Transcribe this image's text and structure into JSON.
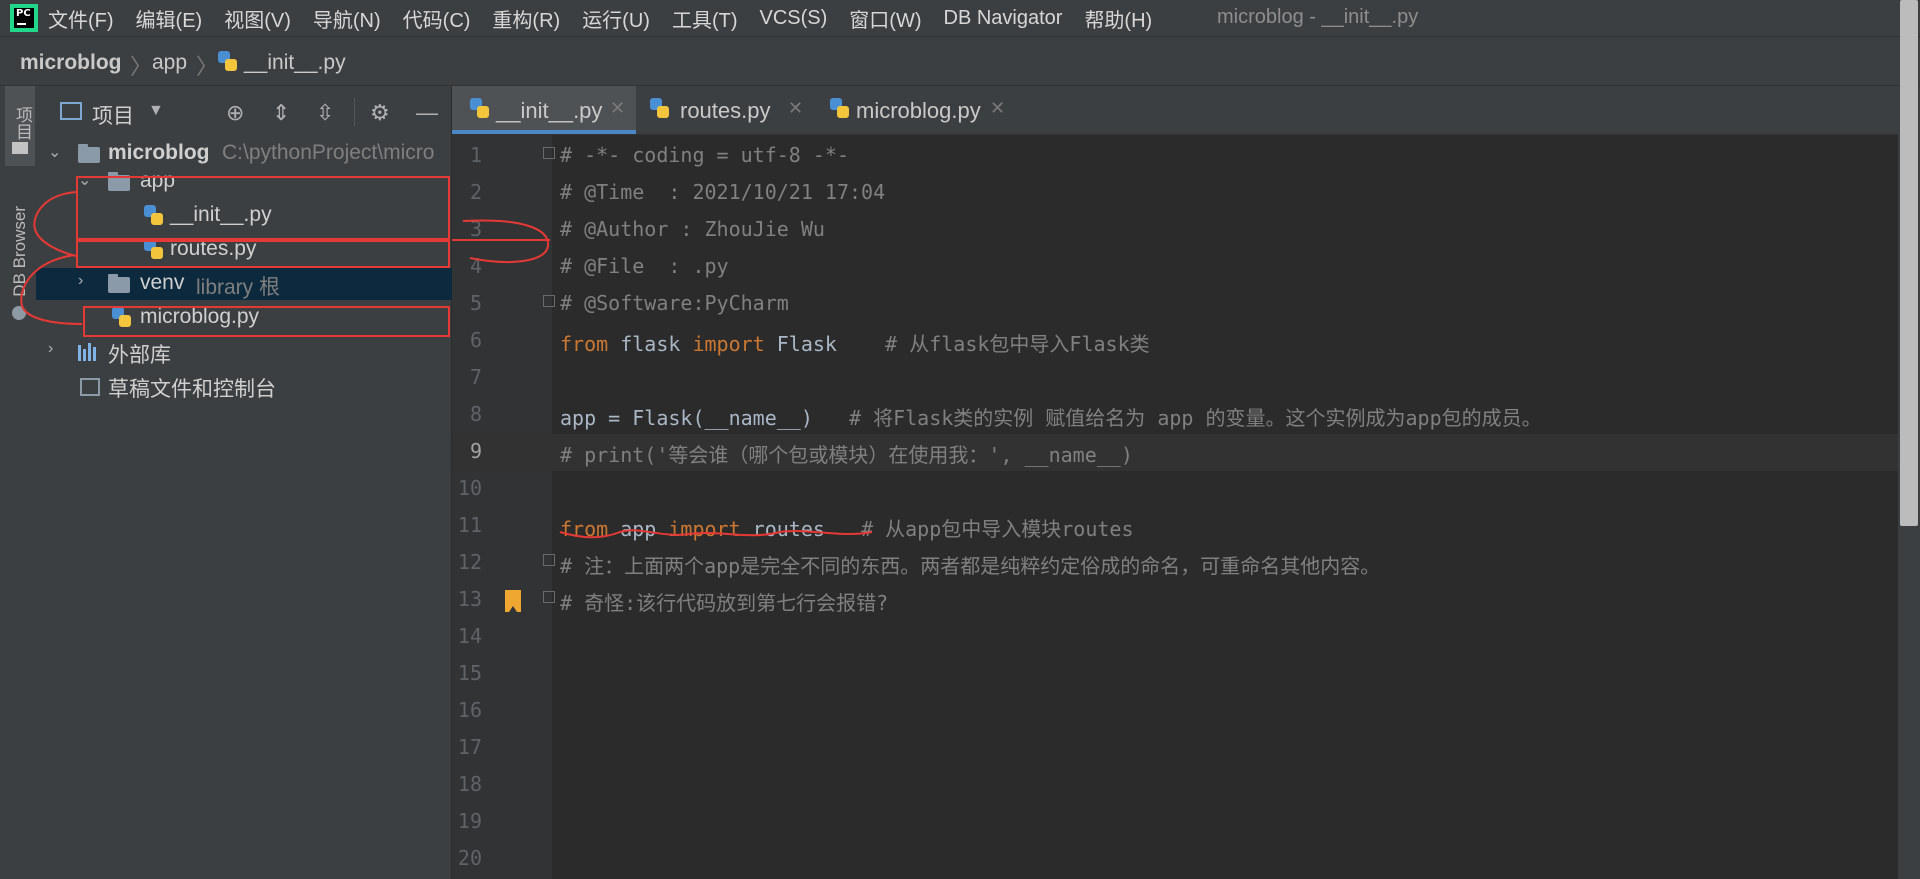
{
  "app": {
    "logo_text": "PC",
    "menus": [
      "文件(F)",
      "编辑(E)",
      "视图(V)",
      "导航(N)",
      "代码(C)",
      "重构(R)",
      "运行(U)",
      "工具(T)",
      "VCS(S)",
      "窗口(W)",
      "DB Navigator",
      "帮助(H)"
    ],
    "window_title": "microblog - __init__.py"
  },
  "breadcrumb": [
    "microblog",
    "app",
    "__init__.py"
  ],
  "toolstrip": {
    "project_label": "项目",
    "db_browser_label": "DB Browser"
  },
  "project_panel": {
    "title": "项目",
    "tree": [
      {
        "label": "microblog",
        "hint": "C:\\pythonProject\\micro"
      },
      {
        "label": "app"
      },
      {
        "label": "__init__.py"
      },
      {
        "label": "routes.py"
      },
      {
        "label": "venv",
        "hint": "library 根"
      },
      {
        "label": "microblog.py"
      },
      {
        "label": "外部库"
      },
      {
        "label": "草稿文件和控制台"
      }
    ]
  },
  "tabs": [
    {
      "label": "__init__.py",
      "active": true
    },
    {
      "label": "routes.py",
      "active": false
    },
    {
      "label": "microblog.py",
      "active": false
    }
  ],
  "editor": {
    "current_line": 9,
    "line_numbers": [
      "1",
      "2",
      "3",
      "4",
      "5",
      "6",
      "7",
      "8",
      "9",
      "10",
      "11",
      "12",
      "13",
      "14",
      "15",
      "16",
      "17",
      "18",
      "19",
      "20"
    ],
    "lines": {
      "l1": "# -*- coding = utf-8 -*-",
      "l2": "# @Time  : 2021/10/21 17:04",
      "l3": "# @Author : ZhouJie Wu",
      "l4": "# @File  : .py",
      "l5": "# @Software:PyCharm",
      "l6": {
        "kw1": "from",
        "mod": " flask ",
        "kw2": "import",
        "name": " Flask    ",
        "comment": "# 从flask包中导入Flask类"
      },
      "l8": {
        "code": "app = Flask(__name__)   ",
        "comment": "# 将Flask类的实例 赋值给名为 app 的变量。这个实例成为app包的成员。"
      },
      "l9": "# print('等会谁（哪个包或模块）在使用我：', __name__)",
      "l11": {
        "kw1": "from",
        "mod": " app ",
        "kw2": "import",
        "name": " routes   ",
        "comment": "# 从app包中导入模块routes"
      },
      "l12": "# 注：上面两个app是完全不同的东西。两者都是纯粹约定俗成的命名，可重命名其他内容。",
      "l13": "# 奇怪:该行代码放到第七行会报错?"
    }
  },
  "colors": {
    "annotation_red": "#e53935",
    "keyword": "#cc7832",
    "comment": "#808080",
    "tab_accent": "#4a88c7"
  }
}
